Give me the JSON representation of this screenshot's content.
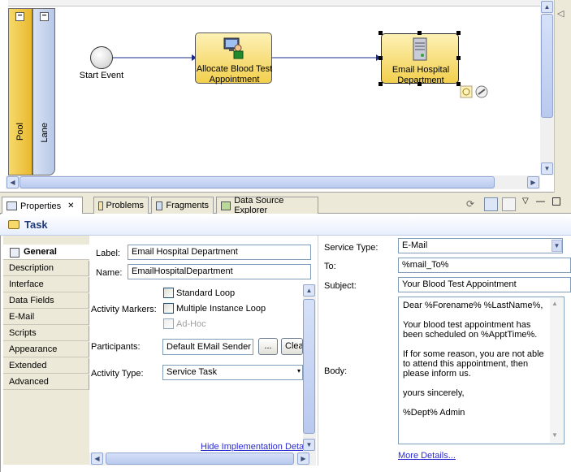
{
  "diagram": {
    "pool_label": "Pool",
    "lane_label": "Lane",
    "start_event_label": "Start Event",
    "task1_label": "Allocate Blood Test Appointment",
    "task2_label": "Email Hospital Department"
  },
  "tabs": [
    {
      "label": "Properties"
    },
    {
      "label": "Problems"
    },
    {
      "label": "Fragments"
    },
    {
      "label": "Data Source Explorer"
    }
  ],
  "header": {
    "title": "Task"
  },
  "nav": [
    "General",
    "Description",
    "Interface",
    "Data Fields",
    "E-Mail",
    "Scripts",
    "Appearance",
    "Extended",
    "Advanced"
  ],
  "general": {
    "label_caption": "Label:",
    "label_value": "Email Hospital Department",
    "name_caption": "Name:",
    "name_value": "EmailHospitalDepartment",
    "activity_markers_caption": "Activity Markers:",
    "standard_loop": "Standard Loop",
    "multiple_instance_loop": "Multiple Instance Loop",
    "ad_hoc": "Ad-Hoc",
    "participants_caption": "Participants:",
    "participants_value": "Default EMail Sender",
    "ellipsis_button": "...",
    "clear_button": "Clea",
    "activity_type_caption": "Activity Type:",
    "activity_type_value": "Service Task",
    "hide_link": "Hide Implementation Deta"
  },
  "email": {
    "service_type_caption": "Service Type:",
    "service_type_value": "E-Mail",
    "to_caption": "To:",
    "to_value": "%mail_To%",
    "subject_caption": "Subject:",
    "subject_value": "Your Blood Test Appointment",
    "body_caption": "Body:",
    "body_value": "Dear %Forename% %LastName%,\n\nYour blood test appointment has\nbeen scheduled on %ApptTime%.\n\nIf for some reason, you are not able\nto attend this appointment, then\nplease inform us.\n\nyours sincerely,\n\n%Dept% Admin",
    "more_details_link": "More Details..."
  }
}
